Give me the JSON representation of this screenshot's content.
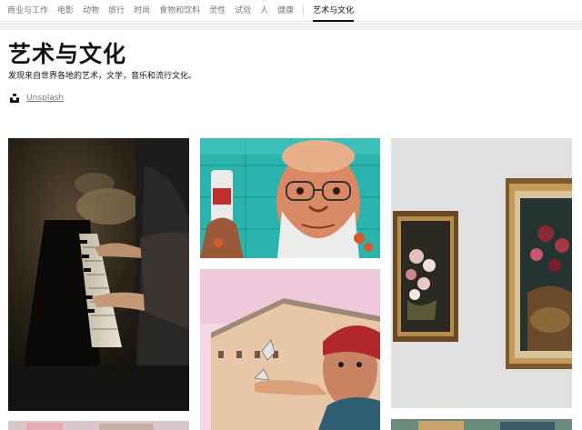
{
  "nav": {
    "items": [
      {
        "label": "商业与工作"
      },
      {
        "label": "电影"
      },
      {
        "label": "动物"
      },
      {
        "label": "旅行"
      },
      {
        "label": "时尚"
      },
      {
        "label": "食物和饮料"
      },
      {
        "label": "灵性"
      },
      {
        "label": "试验"
      },
      {
        "label": "人"
      },
      {
        "label": "健康"
      },
      {
        "label": "艺术与文化"
      }
    ],
    "active": "艺术与文化"
  },
  "header": {
    "title": "艺术与文化",
    "description": "发现来自世界各地的艺术，文学，音乐和流行文化。",
    "source_label": "Unsplash"
  },
  "photos": [
    {
      "subject": "piano-player",
      "column": 1
    },
    {
      "subject": "street-art-man-with-glasses",
      "column": 2
    },
    {
      "subject": "mural-building",
      "column": 2
    },
    {
      "subject": "framed-flower-paintings",
      "column": 3
    }
  ],
  "colors": {
    "active": "#111111",
    "muted": "#767676"
  }
}
